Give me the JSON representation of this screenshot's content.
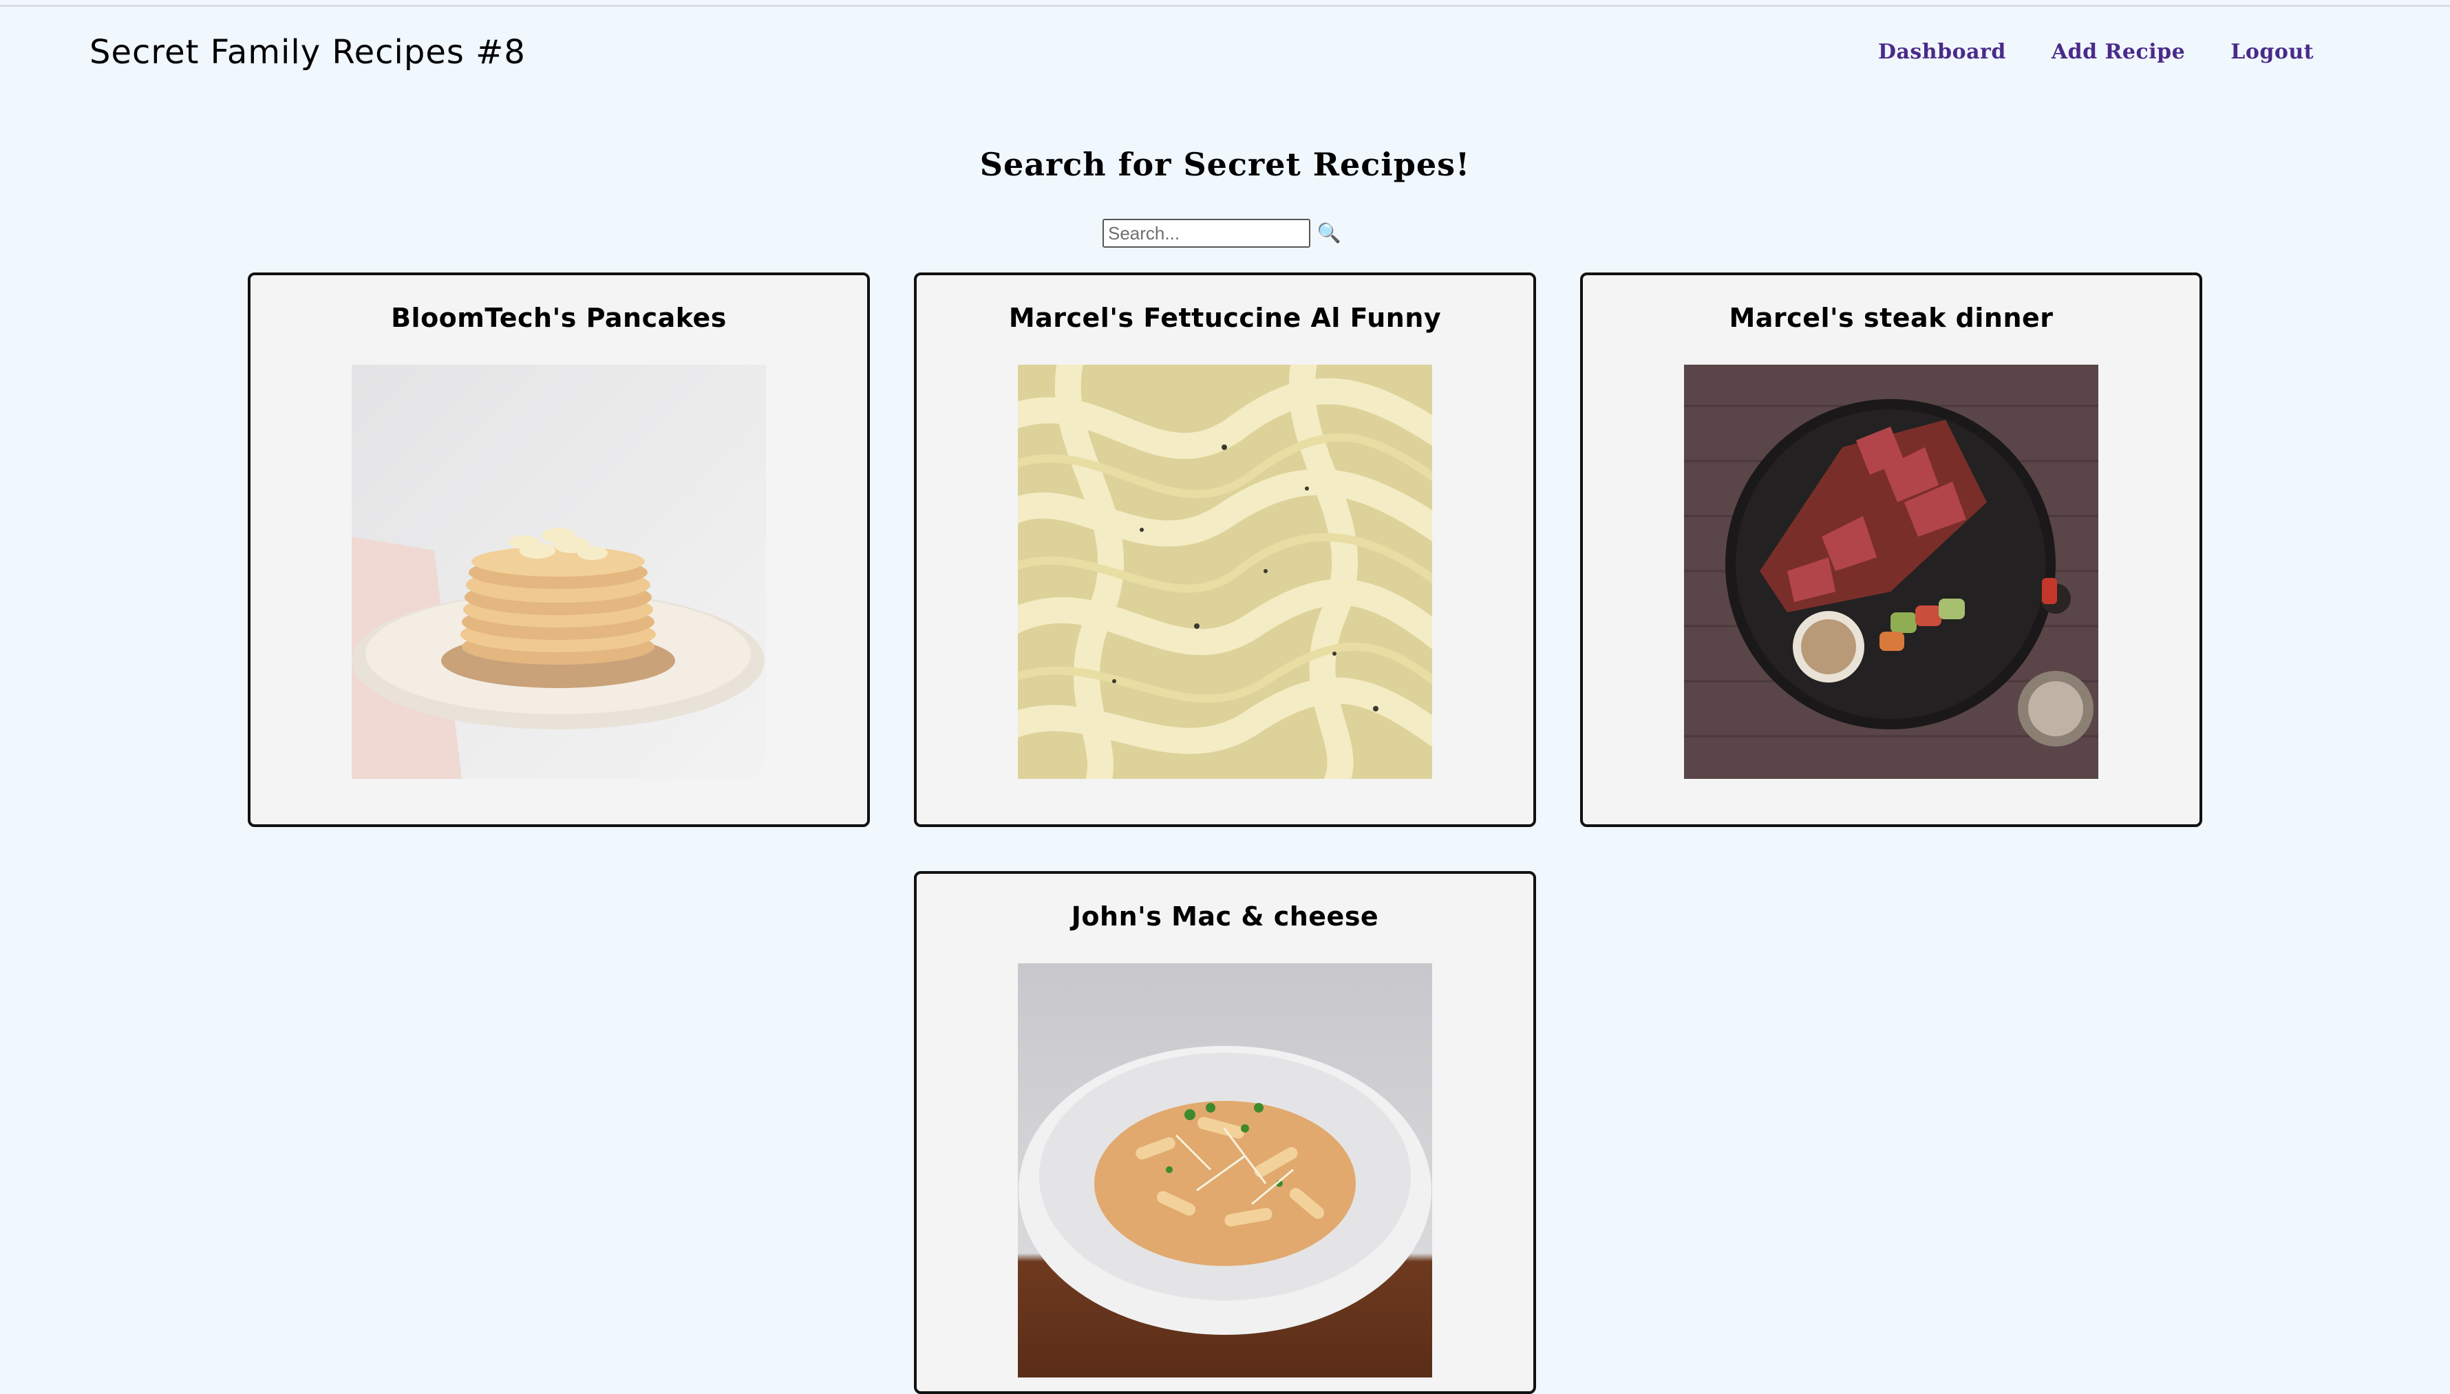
{
  "header": {
    "brand": "Secret Family Recipes #8",
    "nav": [
      "Dashboard",
      "Add Recipe",
      "Logout"
    ]
  },
  "search": {
    "title": "Search for Secret Recipes!",
    "placeholder": "Search...",
    "icon": "magnifier-icon"
  },
  "recipes": [
    {
      "title": "BloomTech's Pancakes",
      "image": "pancakes-photo"
    },
    {
      "title": "Marcel's Fettuccine Al Funny",
      "image": "fettuccine-photo"
    },
    {
      "title": "Marcel's steak dinner",
      "image": "steak-photo"
    },
    {
      "title": "John's Mac & cheese",
      "image": "mac-and-cheese-photo"
    }
  ],
  "colors": {
    "background": "#f0f7fd",
    "nav_link": "#4a2a8a",
    "card_bg": "#f4f4f4",
    "card_border": "#111111"
  }
}
